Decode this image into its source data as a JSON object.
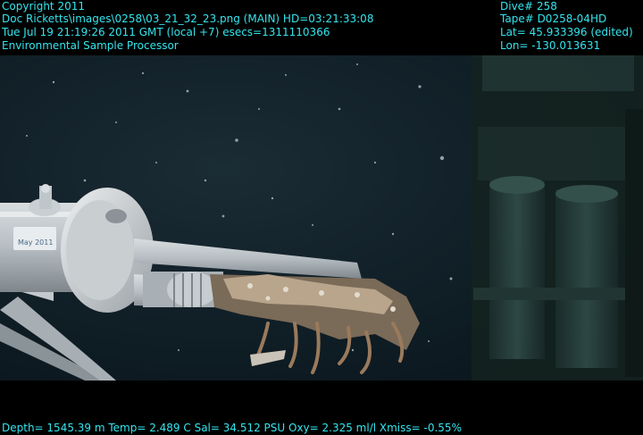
{
  "overlay": {
    "top_left": [
      "Copyright 2011",
      "Doc Ricketts\\images\\0258\\03_21_32_23.png (MAIN)  HD=03:21:33:08",
      "Tue Jul 19 21:19:26 2011 GMT (local +7)  esecs=1311110366",
      "Environmental Sample Processor"
    ],
    "top_right": [
      "Dive# 258",
      "Tape# D0258-04HD",
      "Lat= 45.933396 (edited)",
      "Lon= -130.013631"
    ],
    "bottom": "Depth= 1545.39 m  Temp= 2.489 C  Sal= 34.512 PSU  Oxy= 2.325 ml/l  Xmiss= -0.55%"
  },
  "scene": {
    "equipment_label": "May 2011"
  },
  "colors": {
    "overlay_text": "#33e5ee",
    "water_dark": "#0d1a22",
    "water_light": "#1c3038",
    "instrument_green": "#2f4a42"
  }
}
